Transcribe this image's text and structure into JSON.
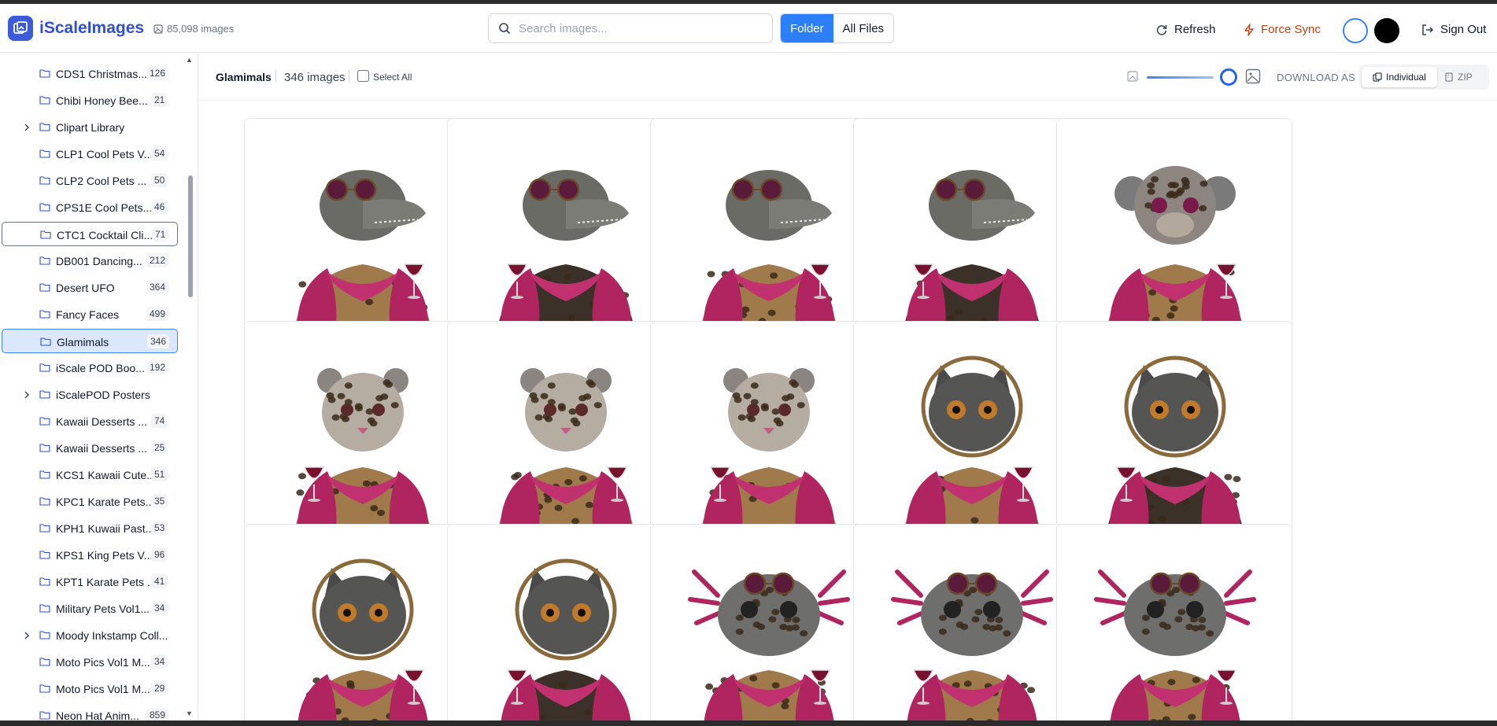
{
  "header": {
    "app_name": "iScaleImages",
    "image_count": "85,098 images",
    "search_placeholder": "Search images...",
    "view_toggle": {
      "folder": "Folder",
      "all_files": "All Files"
    },
    "refresh": "Refresh",
    "force_sync": "Force Sync",
    "sign_out": "Sign Out"
  },
  "sidebar": {
    "items": [
      {
        "label": "CDS1 Christmas...",
        "count": "126"
      },
      {
        "label": "Chibi Honey Bee...",
        "count": "21"
      },
      {
        "label": "Clipart Library",
        "count": "",
        "expandable": true
      },
      {
        "label": "CLP1 Cool Pets V...",
        "count": "54"
      },
      {
        "label": "CLP2 Cool Pets ...",
        "count": "50"
      },
      {
        "label": "CPS1E Cool Pets...",
        "count": "46"
      },
      {
        "label": "CTC1 Cocktail Cli...",
        "count": "71"
      },
      {
        "label": "DB001 Dancing...",
        "count": "212"
      },
      {
        "label": "Desert UFO",
        "count": "364"
      },
      {
        "label": "Fancy Faces",
        "count": "499"
      },
      {
        "label": "Glamimals",
        "count": "346",
        "active": true
      },
      {
        "label": "iScale POD Boo...",
        "count": "192"
      },
      {
        "label": "iScalePOD Posters",
        "count": "",
        "expandable": true
      },
      {
        "label": "Kawaii Desserts ...",
        "count": "74"
      },
      {
        "label": "Kawaii Desserts ...",
        "count": "25"
      },
      {
        "label": "KCS1 Kawaii Cute...",
        "count": "51"
      },
      {
        "label": "KPC1 Karate Pets...",
        "count": "35"
      },
      {
        "label": "KPH1 Kuwaii Past...",
        "count": "53"
      },
      {
        "label": "KPS1 King Pets V...",
        "count": "96"
      },
      {
        "label": "KPT1 Karate Pets ...",
        "count": "41"
      },
      {
        "label": "Military Pets Vol1...",
        "count": "34"
      },
      {
        "label": "Moody Inkstamp Coll...",
        "count": "",
        "expandable": true
      },
      {
        "label": "Moto Pics Vol1 M...",
        "count": "34"
      },
      {
        "label": "Moto Pics Vol1 M...",
        "count": "29"
      },
      {
        "label": "Neon Hat Anim...",
        "count": "859"
      }
    ]
  },
  "toolbar": {
    "folder_title": "Glamimals",
    "image_count": "346 images",
    "select_all": "Select All",
    "size_slider_fraction": 0.95,
    "download_as": "DOWNLOAD AS",
    "individual": "Individual",
    "zip": "ZIP"
  },
  "grid": {
    "images": [
      {
        "animal": "crocodile"
      },
      {
        "animal": "crocodile"
      },
      {
        "animal": "crocodile"
      },
      {
        "animal": "crocodile"
      },
      {
        "animal": "monkey"
      },
      {
        "animal": "leopard"
      },
      {
        "animal": "leopard"
      },
      {
        "animal": "leopard"
      },
      {
        "animal": "cat"
      },
      {
        "animal": "cat"
      },
      {
        "animal": "cat"
      },
      {
        "animal": "cat"
      },
      {
        "animal": "axolotl"
      },
      {
        "animal": "axolotl"
      },
      {
        "animal": "axolotl"
      }
    ]
  },
  "colors": {
    "brand": "#2f4fd6",
    "accent": "#2d7ff9",
    "force_sync": "#c2410c",
    "fur_pink": "#b0245f",
    "leopard_tan": "#a07a4a"
  }
}
